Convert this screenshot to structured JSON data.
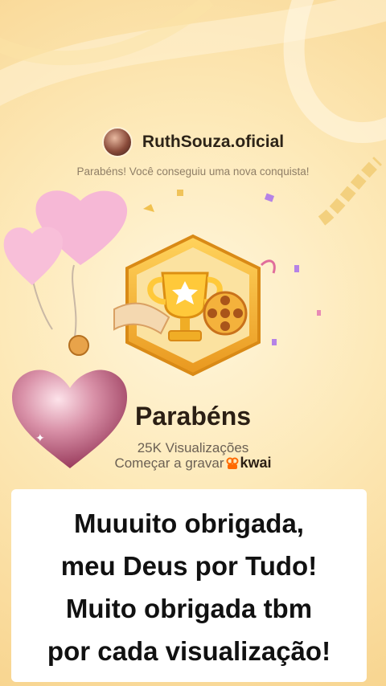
{
  "profile": {
    "username": "RuthSouza.oficial"
  },
  "subtitle": "Parabéns! Você conseguiu uma nova conquista!",
  "achievement": {
    "title": "Parabéns",
    "views": "25K Visualizações",
    "record_label": "Começar a gravar",
    "brand": "kwai"
  },
  "caption": {
    "lines": [
      "Muuuito obrigada,",
      "meu Deus por Tudo!",
      "Muito obrigada tbm",
      "por cada visualização!"
    ]
  },
  "icons": [
    "avatar",
    "trophy-icon",
    "film-reel-icon",
    "balloon-heart-icon",
    "heart-icon",
    "kwai-logo-icon",
    "confetti-icon"
  ],
  "colors": {
    "background": "#fde9b8",
    "badge_gold": "#f5b632",
    "heart_pink": "#f3a9cf",
    "text_dark": "#2b1f14"
  }
}
